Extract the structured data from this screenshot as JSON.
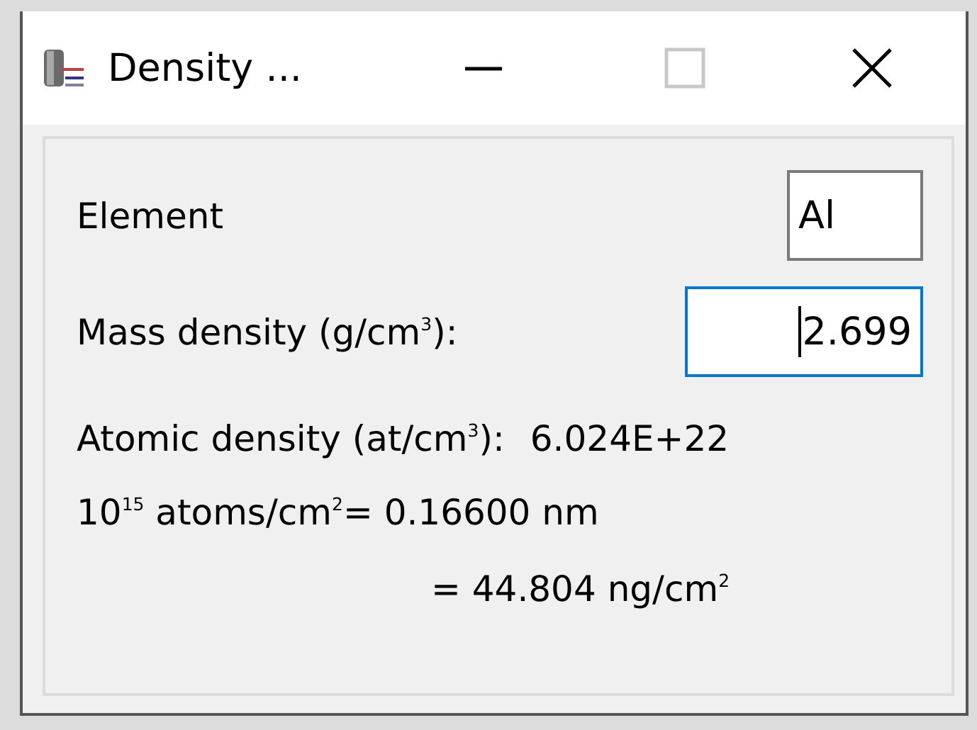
{
  "window": {
    "title": "Density ...",
    "buttons": [
      {
        "kind": "minimize",
        "disabled": false
      },
      {
        "kind": "maximize",
        "disabled": true
      },
      {
        "kind": "close",
        "disabled": false
      }
    ]
  },
  "fields": [
    {
      "label": "Element",
      "value": "Al",
      "focused": false
    },
    {
      "label": "Mass density (g/cm$^{3}$):",
      "value": "2.699",
      "focused": true
    }
  ],
  "results": [
    {
      "label": "Atomic density (at/cm$^{3}$):",
      "value": "6.024E+22"
    }
  ],
  "conversions": [
    {
      "text": "10$^{15}$ atoms/cm$^{2}$= 0.16600 nm",
      "indent": false
    },
    {
      "text": "= 44.804 ng/cm$^{2}$",
      "indent": true
    }
  ]
}
